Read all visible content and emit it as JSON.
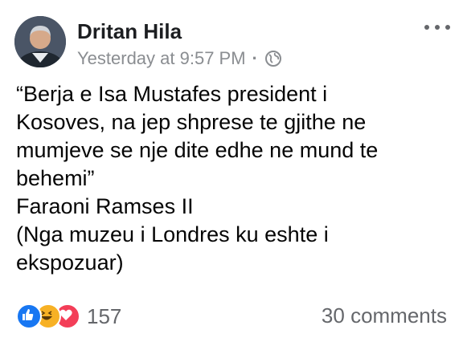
{
  "post": {
    "author": "Dritan Hila",
    "timestamp": "Yesterday at 9:57 PM",
    "separator": "·",
    "privacy_icon": "globe-icon",
    "menu_icon": "more-options-icon",
    "lines": [
      "“Berja e Isa Mustafes president i",
      "Kosoves, na jep shprese te gjithe ne",
      "mumjeve se nje dite edhe ne mund te",
      "behemi”",
      "Faraoni Ramses II",
      "(Nga muzeu i Londres ku eshte i",
      "ekspozuar)"
    ]
  },
  "footer": {
    "reaction_icons": [
      "like-icon",
      "haha-icon",
      "love-icon"
    ],
    "reaction_count": "157",
    "comments": "30 comments"
  },
  "colors": {
    "like": "#1877f2",
    "haha": "#f7b125",
    "love": "#f33e58",
    "secondary_text": "#65676b"
  }
}
